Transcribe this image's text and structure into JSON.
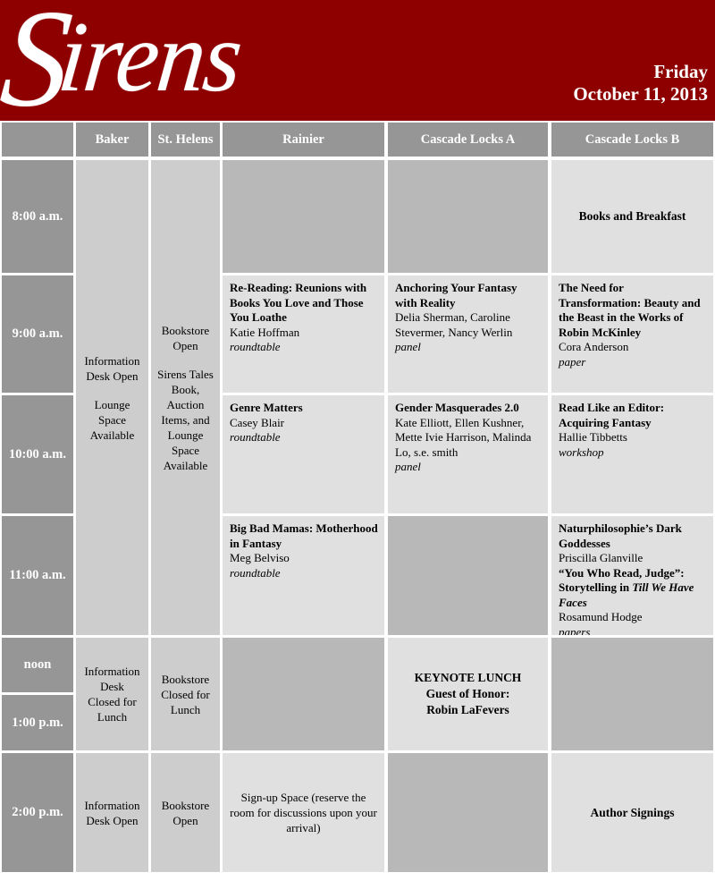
{
  "banner": {
    "logo_text": "Sirens",
    "logo_cap": "S",
    "logo_rest": "irens",
    "day": "Friday",
    "date": "October 11, 2013",
    "background_color": "#8e0000",
    "text_color": "#ffffff"
  },
  "colors": {
    "header_gray": "#969696",
    "empty_gray": "#b8b8b8",
    "service_gray": "#cdcdcd",
    "content_gray": "#e0e0e0",
    "brand_red": "#8e0000"
  },
  "columns": [
    {
      "key": "time",
      "label": ""
    },
    {
      "key": "baker",
      "label": "Baker"
    },
    {
      "key": "sthelens",
      "label": "St. Helens"
    },
    {
      "key": "rainier",
      "label": "Rainier"
    },
    {
      "key": "cascade_a",
      "label": "Cascade Locks A"
    },
    {
      "key": "cascade_b",
      "label": "Cascade Locks B"
    }
  ],
  "times": [
    {
      "key": "t8",
      "label": "8:00 a.m."
    },
    {
      "key": "t9",
      "label": "9:00 a.m."
    },
    {
      "key": "t10",
      "label": "10:00 a.m."
    },
    {
      "key": "t11",
      "label": "11:00 a.m."
    },
    {
      "key": "tnoon",
      "label": "noon"
    },
    {
      "key": "t1",
      "label": "1:00 p.m."
    },
    {
      "key": "t2",
      "label": "2:00 p.m."
    }
  ],
  "services": {
    "baker_morning_line1": "Information",
    "baker_morning_line2": "Desk Open",
    "baker_morning_line3": "Lounge Space",
    "baker_morning_line4": "Available",
    "sthelens_morning_line1": "Bookstore",
    "sthelens_morning_line2": "Open",
    "sthelens_morning_line3": "Sirens Tales",
    "sthelens_morning_line4": "Book, Auction",
    "sthelens_morning_line5": "Items, and",
    "sthelens_morning_line6": "Lounge Space",
    "sthelens_morning_line7": "Available",
    "baker_lunch_line1": "Information",
    "baker_lunch_line2": "Desk",
    "baker_lunch_line3": "Closed for",
    "baker_lunch_line4": "Lunch",
    "sthelens_lunch_line1": "Bookstore",
    "sthelens_lunch_line2": "Closed for",
    "sthelens_lunch_line3": "Lunch",
    "baker_afternoon_line1": "Information",
    "baker_afternoon_line2": "Desk Open",
    "sthelens_afternoon_line1": "Bookstore",
    "sthelens_afternoon_line2": "Open"
  },
  "sessions": {
    "books_and_breakfast": "Books and Breakfast",
    "rainier_9": {
      "title": "Re-Reading: Reunions with Books You Love and Those You Loathe",
      "people": "Katie Hoffman",
      "kind": "roundtable"
    },
    "cascade_a_9": {
      "title": "Anchoring Your Fantasy with Reality",
      "people": "Delia Sherman, Caroline Stevermer, Nancy Werlin",
      "kind": "panel"
    },
    "cascade_b_9": {
      "title": "The Need for Transformation: Beauty and the Beast in the Works of Robin McKinley",
      "people": "Cora Anderson",
      "kind": "paper"
    },
    "rainier_10": {
      "title": "Genre Matters",
      "people": "Casey Blair",
      "kind": "roundtable"
    },
    "cascade_a_10": {
      "title": "Gender Masquerades 2.0",
      "people": "Kate Elliott, Ellen Kushner, Mette Ivie Harrison, Malinda Lo, s.e. smith",
      "kind": "panel"
    },
    "cascade_b_10": {
      "title": "Read Like an Editor: Acquiring Fantasy",
      "people": "Hallie Tibbetts",
      "kind": "workshop"
    },
    "rainier_11": {
      "title": "Big Bad Mamas: Motherhood in Fantasy",
      "people": "Meg Belviso",
      "kind": "roundtable"
    },
    "cascade_b_11": {
      "title_a": "Naturphilosophie’s Dark Goddesses",
      "people_a": "Priscilla Glanville",
      "title_b_part1": "“You Who Read, Judge”: Storytelling in ",
      "title_b_italic": "Till We Have Faces",
      "people_b": "Rosamund Hodge",
      "kind": "papers"
    },
    "keynote": {
      "line1": "KEYNOTE LUNCH",
      "line2": "Guest of Honor:",
      "line3": "Robin LaFevers"
    },
    "rainier_2": "Sign-up Space (reserve the room for discussions upon your arrival)",
    "author_signings": "Author Signings"
  }
}
